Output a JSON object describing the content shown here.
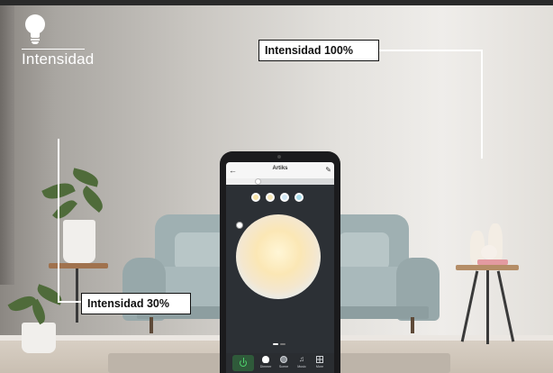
{
  "header": {
    "title": "Intensidad",
    "icon": "lightbulb-icon"
  },
  "callouts": {
    "max_label": "Intensidad 100%",
    "min_label": "Intensidad 30%"
  },
  "app": {
    "title": "Artiks",
    "back_icon": "back-arrow-icon",
    "edit_icon": "edit-pencil-icon",
    "brightness_level": 0.3,
    "presets": [
      {
        "color": "#f8e4a8"
      },
      {
        "color": "#f6e7b8"
      },
      {
        "color": "#cfe6f3"
      },
      {
        "color": "#a9ddec"
      }
    ],
    "nav": [
      {
        "label": "Dimmer",
        "icon": "bulb-icon"
      },
      {
        "label": "Scene",
        "icon": "scene-icon"
      },
      {
        "label": "Music",
        "icon": "music-icon"
      },
      {
        "label": "More",
        "icon": "grid-icon"
      }
    ],
    "accent": "#4fd16c"
  }
}
